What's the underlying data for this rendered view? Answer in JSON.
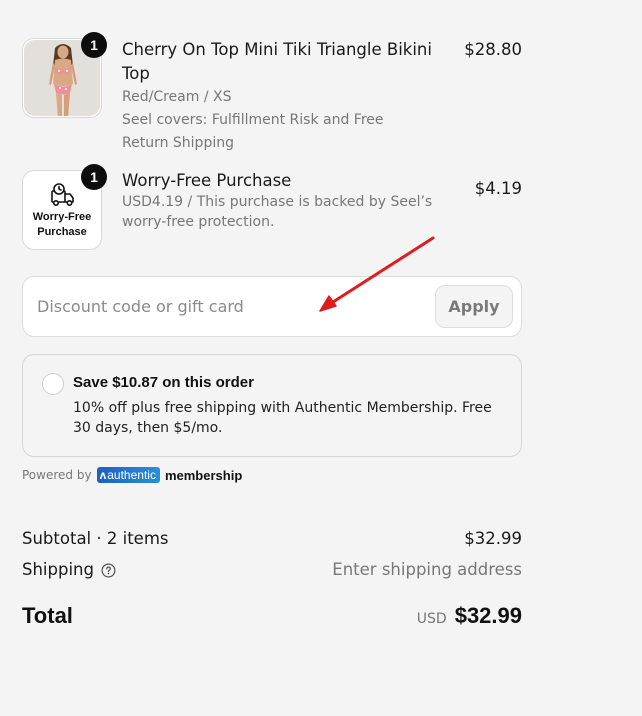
{
  "items": [
    {
      "quantity": "1",
      "name": "Cherry On Top Mini Tiki Triangle Bikini Top",
      "variant": "Red/Cream / XS",
      "note": "Seel covers: Fulfillment Risk and Free Return Shipping",
      "price": "$28.80"
    },
    {
      "quantity": "1",
      "thumb_label_line1": "Worry-Free",
      "thumb_label_line2": "Purchase",
      "name": "Worry-Free Purchase",
      "note": "USD4.19 / This purchase is backed by Seel’s worry-free protection.",
      "price": "$4.19"
    }
  ],
  "discount": {
    "placeholder": "Discount code or gift card",
    "apply_label": "Apply"
  },
  "offer": {
    "title": "Save $10.87 on this order",
    "description": "10% off plus free shipping with Authentic Membership. Free 30 days, then $5/mo."
  },
  "powered_by": {
    "prefix": "Powered by",
    "brand": "authentic",
    "suffix": "membership"
  },
  "summary": {
    "subtotal_label": "Subtotal · 2 items",
    "subtotal_value": "$32.99",
    "shipping_label": "Shipping",
    "shipping_value": "Enter shipping address",
    "total_label": "Total",
    "total_currency": "USD",
    "total_value": "$32.99"
  },
  "colors": {
    "background": "#f4f4f4",
    "annotation_arrow": "#e01b1b",
    "badge": "#0d0d0d",
    "authentic_brand": "#1f5fbf"
  }
}
